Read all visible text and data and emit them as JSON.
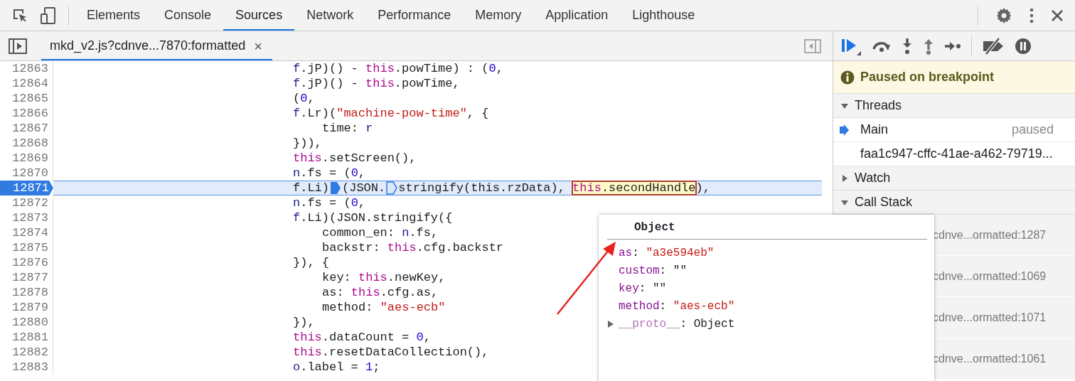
{
  "toolbar": {
    "tabs": [
      {
        "label": "Elements",
        "selected": false
      },
      {
        "label": "Console",
        "selected": false
      },
      {
        "label": "Sources",
        "selected": true
      },
      {
        "label": "Network",
        "selected": false
      },
      {
        "label": "Performance",
        "selected": false
      },
      {
        "label": "Memory",
        "selected": false
      },
      {
        "label": "Application",
        "selected": false
      },
      {
        "label": "Lighthouse",
        "selected": false
      }
    ]
  },
  "editor": {
    "file_tab": {
      "label": "mkd_v2.js?cdnve...7870:formatted",
      "close": "×"
    },
    "lines": [
      {
        "number": "12863",
        "kind": "outer",
        "current": false,
        "tokens": [
          {
            "text": "f",
            "kind": "variable"
          },
          {
            "text": ".jP)() - ",
            "kind": "plain"
          },
          {
            "text": "this",
            "kind": "keyword"
          },
          {
            "text": ".powTime) : (",
            "kind": "plain"
          },
          {
            "text": "0",
            "kind": "number"
          },
          {
            "text": ",",
            "kind": "plain"
          }
        ]
      },
      {
        "number": "12864",
        "kind": "outer",
        "current": false,
        "tokens": [
          {
            "text": "f",
            "kind": "variable"
          },
          {
            "text": ".jP)() - ",
            "kind": "plain"
          },
          {
            "text": "this",
            "kind": "keyword"
          },
          {
            "text": ".powTime,",
            "kind": "plain"
          }
        ]
      },
      {
        "number": "12865",
        "kind": "outer",
        "current": false,
        "tokens": [
          {
            "text": "(",
            "kind": "plain"
          },
          {
            "text": "0",
            "kind": "number"
          },
          {
            "text": ",",
            "kind": "plain"
          }
        ]
      },
      {
        "number": "12866",
        "kind": "outer",
        "current": false,
        "tokens": [
          {
            "text": "f",
            "kind": "variable"
          },
          {
            "text": ".Lr)(",
            "kind": "plain"
          },
          {
            "text": "\"machine-pow-time\"",
            "kind": "string"
          },
          {
            "text": ", {",
            "kind": "plain"
          }
        ]
      },
      {
        "number": "12867",
        "kind": "inner",
        "current": false,
        "tokens": [
          {
            "text": "time: ",
            "kind": "plain"
          },
          {
            "text": "r",
            "kind": "variable"
          }
        ]
      },
      {
        "number": "12868",
        "kind": "outer",
        "current": false,
        "tokens": [
          {
            "text": "})),",
            "kind": "plain"
          }
        ]
      },
      {
        "number": "12869",
        "kind": "outer",
        "current": false,
        "tokens": [
          {
            "text": "this",
            "kind": "keyword"
          },
          {
            "text": ".setScreen(),",
            "kind": "plain"
          }
        ]
      },
      {
        "number": "12870",
        "kind": "outer",
        "current": false,
        "tokens": [
          {
            "text": "n",
            "kind": "variable"
          },
          {
            "text": ".fs = (",
            "kind": "plain"
          },
          {
            "text": "0",
            "kind": "number"
          },
          {
            "text": ",",
            "kind": "plain"
          }
        ]
      },
      {
        "number": "12871",
        "kind": "outer",
        "current": true,
        "tokens": [
          {
            "text": "f.Li)",
            "kind": "plain"
          },
          {
            "kind": "marker",
            "active": true
          },
          {
            "text": "(JSON.",
            "kind": "plain"
          },
          {
            "kind": "marker",
            "active": false
          },
          {
            "text": "stringify(this.rzData), ",
            "kind": "plain"
          },
          {
            "kind": "hover",
            "tokens": [
              {
                "text": "this",
                "kind": "keyword"
              },
              {
                "text": ".secondHandle",
                "kind": "plain"
              }
            ]
          },
          {
            "text": "),",
            "kind": "plain"
          }
        ]
      },
      {
        "number": "12872",
        "kind": "outer",
        "current": false,
        "tokens": [
          {
            "text": "n",
            "kind": "variable"
          },
          {
            "text": ".fs = (",
            "kind": "plain"
          },
          {
            "text": "0",
            "kind": "number"
          },
          {
            "text": ",",
            "kind": "plain"
          }
        ]
      },
      {
        "number": "12873",
        "kind": "outer",
        "current": false,
        "tokens": [
          {
            "text": "f",
            "kind": "variable"
          },
          {
            "text": ".Li)(JSON.stringify({",
            "kind": "plain"
          }
        ]
      },
      {
        "number": "12874",
        "kind": "inner",
        "current": false,
        "tokens": [
          {
            "text": "common_en: ",
            "kind": "plain"
          },
          {
            "text": "n",
            "kind": "variable"
          },
          {
            "text": ".fs,",
            "kind": "plain"
          }
        ]
      },
      {
        "number": "12875",
        "kind": "inner",
        "current": false,
        "tokens": [
          {
            "text": "backstr: ",
            "kind": "plain"
          },
          {
            "text": "this",
            "kind": "keyword"
          },
          {
            "text": ".cfg.backstr",
            "kind": "plain"
          }
        ]
      },
      {
        "number": "12876",
        "kind": "outer",
        "current": false,
        "tokens": [
          {
            "text": "}), {",
            "kind": "plain"
          }
        ]
      },
      {
        "number": "12877",
        "kind": "inner",
        "current": false,
        "tokens": [
          {
            "text": "key: ",
            "kind": "plain"
          },
          {
            "text": "this",
            "kind": "keyword"
          },
          {
            "text": ".newKey,",
            "kind": "plain"
          }
        ]
      },
      {
        "number": "12878",
        "kind": "inner",
        "current": false,
        "tokens": [
          {
            "text": "as: ",
            "kind": "plain"
          },
          {
            "text": "this",
            "kind": "keyword"
          },
          {
            "text": ".cfg.as,",
            "kind": "plain"
          }
        ]
      },
      {
        "number": "12879",
        "kind": "inner",
        "current": false,
        "tokens": [
          {
            "text": "method: ",
            "kind": "plain"
          },
          {
            "text": "\"aes-ecb\"",
            "kind": "string"
          }
        ]
      },
      {
        "number": "12880",
        "kind": "outer",
        "current": false,
        "tokens": [
          {
            "text": "}),",
            "kind": "plain"
          }
        ]
      },
      {
        "number": "12881",
        "kind": "outer",
        "current": false,
        "tokens": [
          {
            "text": "this",
            "kind": "keyword"
          },
          {
            "text": ".dataCount = ",
            "kind": "plain"
          },
          {
            "text": "0",
            "kind": "number"
          },
          {
            "text": ",",
            "kind": "plain"
          }
        ]
      },
      {
        "number": "12882",
        "kind": "outer",
        "current": false,
        "tokens": [
          {
            "text": "this",
            "kind": "keyword"
          },
          {
            "text": ".resetDataCollection(),",
            "kind": "plain"
          }
        ]
      },
      {
        "number": "12883",
        "kind": "outer",
        "current": false,
        "tokens": [
          {
            "text": "o",
            "kind": "variable"
          },
          {
            "text": ".label = ",
            "kind": "plain"
          },
          {
            "text": "1",
            "kind": "number"
          },
          {
            "text": ";",
            "kind": "plain"
          }
        ]
      }
    ]
  },
  "debugger": {
    "banner": "Paused on breakpoint",
    "sections": [
      {
        "title": "Threads",
        "expanded": true,
        "threads": [
          {
            "name": "Main",
            "status": "paused",
            "current": true
          },
          {
            "name": "faa1c947-cffc-41ae-a462-79719...",
            "current": false
          }
        ]
      },
      {
        "title": "Watch",
        "expanded": false
      },
      {
        "title": "Call Stack",
        "expanded": true,
        "frames": [
          "cdnve...ormatted:1287",
          "cdnve...ormatted:1069",
          "cdnve...ormatted:1071",
          "cdnve...ormatted:1061"
        ]
      }
    ]
  },
  "popover": {
    "title": "Object",
    "properties": [
      {
        "name": "as",
        "separator": ":",
        "value": "\"a3e594eb\"",
        "kind": "string",
        "expandable": false
      },
      {
        "name": "custom",
        "separator": ":",
        "value": "\"\"",
        "kind": "plain",
        "expandable": false
      },
      {
        "name": "key",
        "separator": ":",
        "value": "\"\"",
        "kind": "plain",
        "expandable": false
      },
      {
        "name": "method",
        "separator": ":",
        "value": "\"aes-ecb\"",
        "kind": "string",
        "expandable": false
      },
      {
        "name": "__proto__",
        "separator": ":",
        "value": "Object",
        "kind": "object",
        "expandable": true
      }
    ]
  }
}
